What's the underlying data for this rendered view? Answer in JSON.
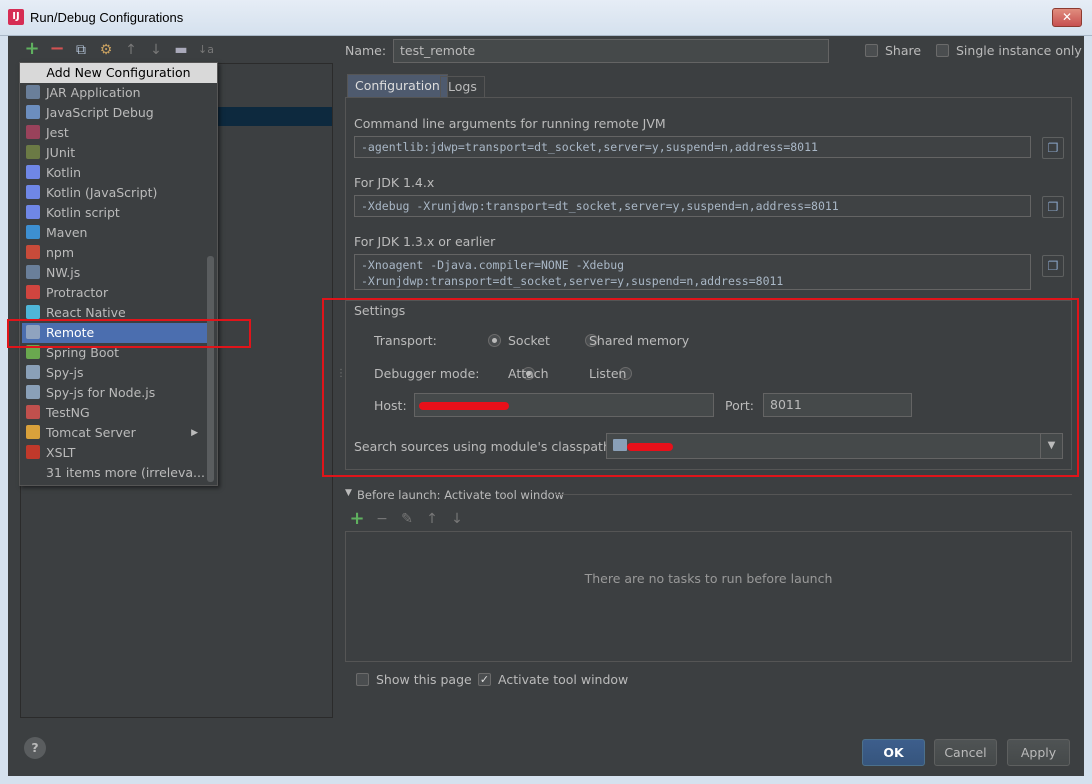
{
  "window": {
    "title": "Run/Debug Configurations",
    "close": "✕",
    "app_icon": "intellij-icon"
  },
  "toolbar": {
    "add": "+",
    "remove": "−",
    "copy": "⧉",
    "wrench": "⚙",
    "up": "↑",
    "down": "↓",
    "folder": "▬",
    "sort": "↓a"
  },
  "popup": {
    "header": "Add New Configuration",
    "items": [
      {
        "label": "JAR Application",
        "icon": "jar-icon",
        "color": "#6a7f9a"
      },
      {
        "label": "JavaScript Debug",
        "icon": "js-debug-icon",
        "color": "#6c8ebf"
      },
      {
        "label": "Jest",
        "icon": "jest-icon",
        "color": "#99425b"
      },
      {
        "label": "JUnit",
        "icon": "junit-icon",
        "color": "#6b7a45"
      },
      {
        "label": "Kotlin",
        "icon": "kotlin-icon",
        "color": "#6f87e6"
      },
      {
        "label": "Kotlin (JavaScript)",
        "icon": "kotlin-js-icon",
        "color": "#6f87e6"
      },
      {
        "label": "Kotlin script",
        "icon": "kotlin-script-icon",
        "color": "#6f87e6"
      },
      {
        "label": "Maven",
        "icon": "maven-icon",
        "color": "#3d8fd1"
      },
      {
        "label": "npm",
        "icon": "npm-icon",
        "color": "#c84b3a"
      },
      {
        "label": "NW.js",
        "icon": "nwjs-icon",
        "color": "#6a7f9a"
      },
      {
        "label": "Protractor",
        "icon": "protractor-icon",
        "color": "#d0453f"
      },
      {
        "label": "React Native",
        "icon": "react-icon",
        "color": "#4fb6d8"
      },
      {
        "label": "Remote",
        "icon": "remote-icon",
        "color": "#8fa3bf",
        "selected": true
      },
      {
        "label": "Spring Boot",
        "icon": "spring-boot-icon",
        "color": "#6aa84f"
      },
      {
        "label": "Spy-js",
        "icon": "spy-js-icon",
        "color": "#8aa0b8"
      },
      {
        "label": "Spy-js for Node.js",
        "icon": "spy-js-node-icon",
        "color": "#8aa0b8"
      },
      {
        "label": "TestNG",
        "icon": "testng-icon",
        "color": "#c0504d"
      },
      {
        "label": "Tomcat Server",
        "icon": "tomcat-icon",
        "color": "#d9a13b",
        "submenu": "▶"
      },
      {
        "label": "XSLT",
        "icon": "xslt-icon",
        "color": "#c0392b"
      },
      {
        "label": "31 items more (irreleva...",
        "icon": "",
        "color": ""
      }
    ]
  },
  "form": {
    "name_label": "Name:",
    "name_value": "test_remote",
    "share_label": "Share",
    "single_instance_label": "Single instance only",
    "tabs": [
      "Configuration",
      "Logs"
    ],
    "cmd_label": "Command line arguments for running remote JVM",
    "cmd_value": "-agentlib:jdwp=transport=dt_socket,server=y,suspend=n,address=8011",
    "jdk14_label": "For JDK 1.4.x",
    "jdk14_value": "-Xdebug -Xrunjdwp:transport=dt_socket,server=y,suspend=n,address=8011",
    "jdk13_label": "For JDK 1.3.x or earlier",
    "jdk13_line1": "-Xnoagent -Djava.compiler=NONE -Xdebug",
    "jdk13_line2": "-Xrunjdwp:transport=dt_socket,server=y,suspend=n,address=8011",
    "settings_label": "Settings",
    "transport_label": "Transport:",
    "transport_socket": "Socket",
    "transport_shared": "Shared memory",
    "debugger_mode_label": "Debugger mode:",
    "mode_attach": "Attach",
    "mode_listen": "Listen",
    "host_label": "Host:",
    "port_label": "Port:",
    "port_value": "8011",
    "classpath_label": "Search sources using module's classpath:",
    "dropdown_arrow": "▼"
  },
  "before_launch": {
    "title": "Before launch: Activate tool window",
    "empty_text": "There are no tasks to run before launch",
    "add": "+",
    "remove": "−",
    "edit": "✎",
    "up": "↑",
    "down": "↓"
  },
  "footer": {
    "show_page_label": "Show this page",
    "activate_label": "Activate tool window",
    "ok_label": "OK",
    "cancel_label": "Cancel",
    "apply_label": "Apply",
    "help": "?"
  },
  "colors": {
    "accent_red": "#e0141a",
    "selection": "#4b6eaf",
    "background": "#3c3f41"
  }
}
